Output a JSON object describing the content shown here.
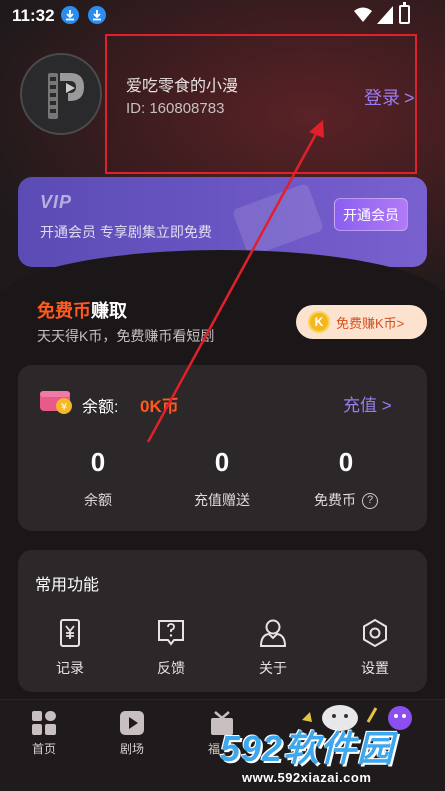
{
  "status_bar": {
    "time": "11:32"
  },
  "profile": {
    "username": "爱吃零食的小漫",
    "id_text": "ID: 160808783",
    "login_label": "登录",
    "login_chevron": ">"
  },
  "vip": {
    "logo_text": "VIP",
    "description": "开通会员   专享剧集立即免费",
    "button_label": "开通会员"
  },
  "free_coins": {
    "title_highlight": "免费币",
    "title_rest": "赚取",
    "subtitle": "天天得K币，免费赚币看短剧",
    "earn_button_label": "免费赚K币>",
    "coin_letter": "K"
  },
  "balance": {
    "label": "余额:",
    "value": "0K币",
    "recharge_label": "充值",
    "recharge_chevron": ">",
    "stats": [
      {
        "value": "0",
        "label": "余额"
      },
      {
        "value": "0",
        "label": "充值赠送"
      },
      {
        "value": "0",
        "label": "免费币"
      }
    ],
    "help_glyph": "?"
  },
  "functions": {
    "title": "常用功能",
    "items": [
      {
        "label": "记录",
        "icon": "record-icon"
      },
      {
        "label": "反馈",
        "icon": "feedback-icon"
      },
      {
        "label": "关于",
        "icon": "about-icon"
      },
      {
        "label": "设置",
        "icon": "settings-icon"
      }
    ]
  },
  "bottom_nav": {
    "items": [
      {
        "label": "首页",
        "icon": "home-icon"
      },
      {
        "label": "剧场",
        "icon": "theater-icon"
      },
      {
        "label": "福",
        "icon": "welfare-icon"
      }
    ]
  },
  "watermark": {
    "brand": "592软件园",
    "url": "www.592xiazai.com"
  },
  "colors": {
    "accent_purple": "#9b7cf2",
    "accent_orange": "#ff5a1f",
    "annotation_red": "#e0202a"
  }
}
